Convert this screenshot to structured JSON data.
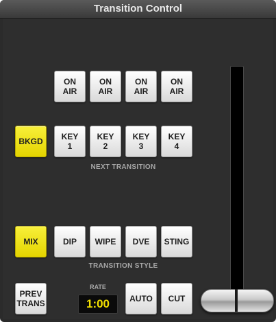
{
  "title": "Transition Control",
  "on_air": [
    {
      "line1": "ON",
      "line2": "AIR"
    },
    {
      "line1": "ON",
      "line2": "AIR"
    },
    {
      "line1": "ON",
      "line2": "AIR"
    },
    {
      "line1": "ON",
      "line2": "AIR"
    }
  ],
  "next_transition": {
    "bkgd": "BKGD",
    "keys": [
      {
        "line1": "KEY",
        "line2": "1"
      },
      {
        "line1": "KEY",
        "line2": "2"
      },
      {
        "line1": "KEY",
        "line2": "3"
      },
      {
        "line1": "KEY",
        "line2": "4"
      }
    ],
    "label": "NEXT TRANSITION"
  },
  "transition_style": {
    "buttons": [
      "MIX",
      "DIP",
      "WIPE",
      "DVE",
      "STING"
    ],
    "label": "TRANSITION STYLE"
  },
  "bottom": {
    "prev_trans": {
      "line1": "PREV",
      "line2": "TRANS"
    },
    "rate_label": "RATE",
    "rate_value": "1:00",
    "auto": "AUTO",
    "cut": "CUT"
  },
  "colors": {
    "active": "#f2e600",
    "panel": "#2e2e2e"
  }
}
